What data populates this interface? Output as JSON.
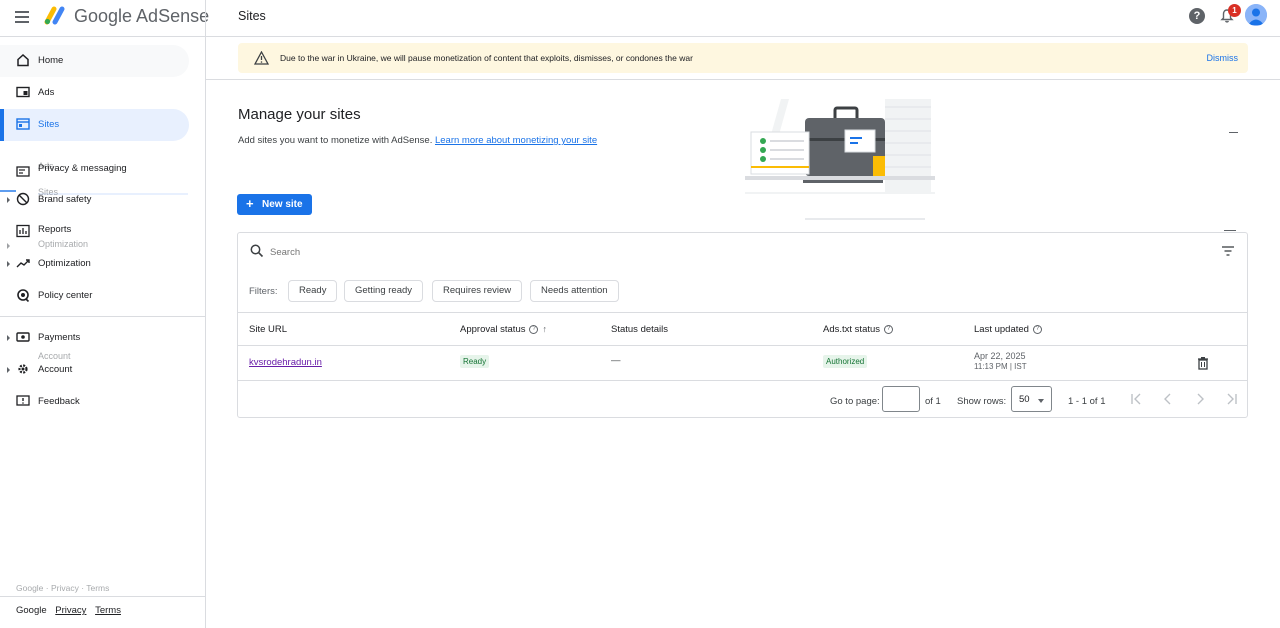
{
  "header": {
    "brand": "Google AdSense",
    "page_title": "Sites",
    "notification_count": "1",
    "help_label": "?"
  },
  "sidebar": {
    "items": [
      {
        "label": "Home",
        "icon": "home-icon"
      },
      {
        "label": "Ads",
        "icon": "ads-icon"
      },
      {
        "label": "Sites",
        "icon": "sites-icon"
      },
      {
        "label": "Privacy & messaging",
        "icon": "privacy-icon"
      },
      {
        "label": "Brand safety",
        "icon": "brand-safety-icon"
      },
      {
        "label": "Reports",
        "icon": "reports-icon"
      },
      {
        "label": "Optimization",
        "icon": "optimization-icon"
      },
      {
        "label": "Policy center",
        "icon": "policy-icon"
      },
      {
        "label": "Payments",
        "icon": "payments-icon"
      },
      {
        "label": "Account",
        "icon": "account-icon"
      },
      {
        "label": "Feedback",
        "icon": "feedback-icon"
      }
    ],
    "ghost_ads": "Ads",
    "ghost_sites": "Sites",
    "ghost_optimization": "Optimization",
    "ghost_account": "Account",
    "ghost_footer": "Google · Privacy · Terms",
    "footer": {
      "google": "Google",
      "privacy": "Privacy",
      "terms": "Terms"
    }
  },
  "banner": {
    "message": "Due to the war in Ukraine, we will pause monetization of content that exploits, dismisses, or condones the war",
    "dismiss": "Dismiss"
  },
  "manage": {
    "title": "Manage your sites",
    "description": "Add sites you want to monetize with AdSense.",
    "learn_more": "Learn more about monetizing your site",
    "new_site_button": "New site"
  },
  "table": {
    "search_placeholder": "Search",
    "filters_label": "Filters:",
    "filter_chips": [
      "Ready",
      "Getting ready",
      "Requires review",
      "Needs attention"
    ],
    "columns": [
      "Site URL",
      "Approval status",
      "Status details",
      "Ads.txt status",
      "Last updated"
    ],
    "rows": [
      {
        "site_url": "kvsrodehradun.in",
        "approval_status": "Ready",
        "status_details": "—",
        "ads_txt_status": "Authorized",
        "last_updated_date": "Apr 22, 2025",
        "last_updated_time": "11:13 PM | IST"
      }
    ],
    "pager": {
      "go_to_page_label": "Go to page:",
      "of_pages": "of 1",
      "show_rows_label": "Show rows:",
      "rows_value": "50",
      "range": "1 - 1 of 1"
    }
  },
  "colors": {
    "accent": "#1a73e8",
    "banner_bg": "#fef7e0",
    "active_nav_bg": "#e8f0fe",
    "status_green": "#137333"
  }
}
